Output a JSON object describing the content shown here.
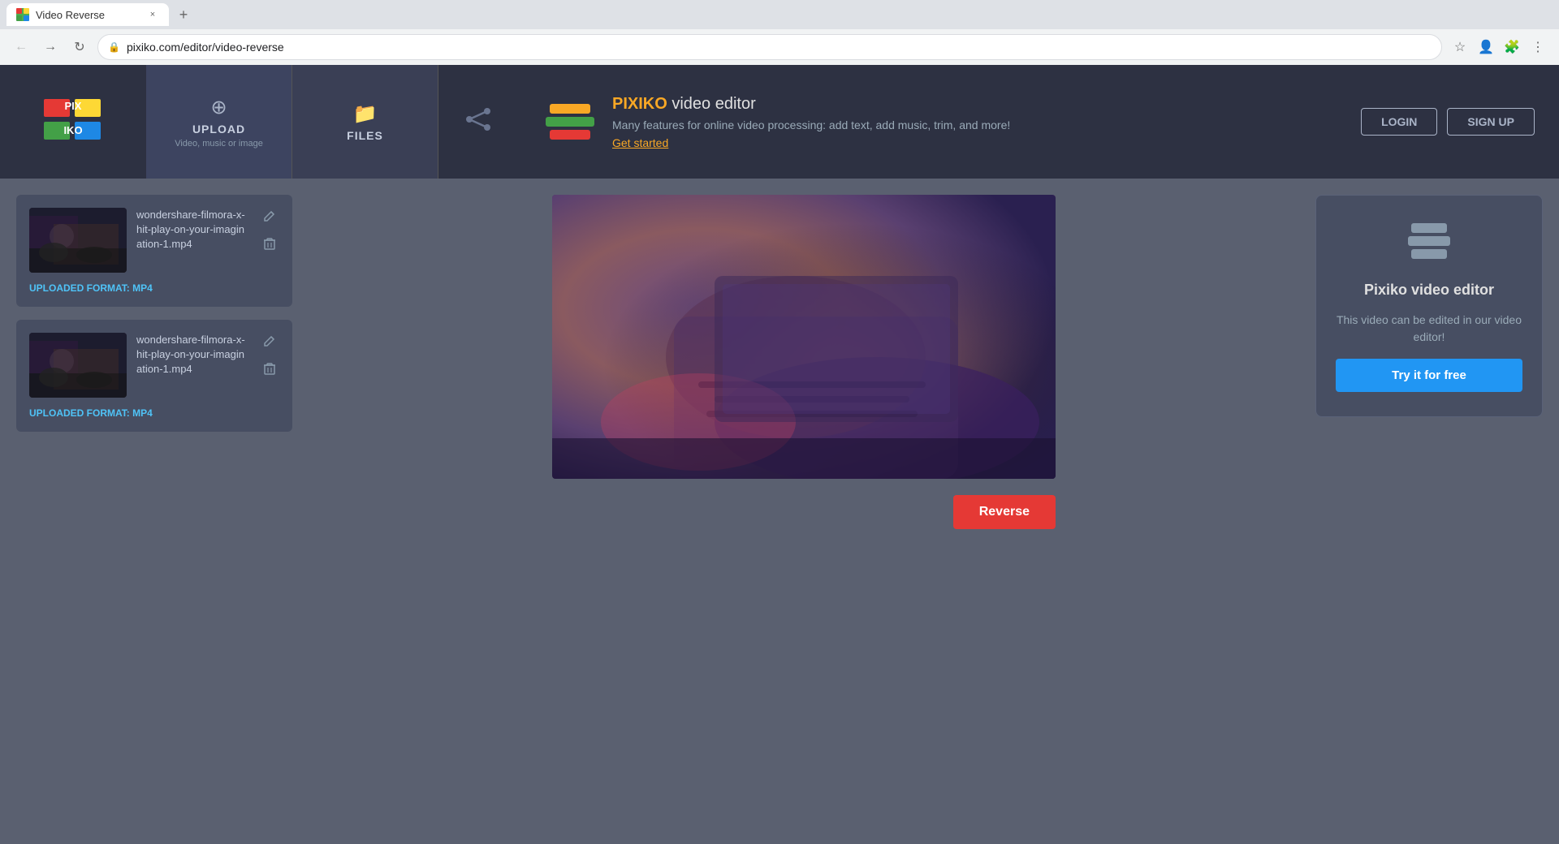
{
  "browser": {
    "tab_title": "Video Reverse",
    "url": "pixiko.com/editor/video-reverse",
    "tab_close": "×",
    "tab_new": "+"
  },
  "header": {
    "logo_text_pix": "PIX",
    "logo_text_iko": "IKO",
    "logo_subtext": "KO",
    "upload_label": "UPLOAD",
    "upload_sublabel": "Video, music or image",
    "files_label": "FILES",
    "promo_title_pixiko": "PIXIKO",
    "promo_title_rest": " video editor",
    "promo_desc": "Many features for online video processing: add text, add music, trim, and more!",
    "promo_link": "Get started",
    "login_label": "LOGIN",
    "signup_label": "SIGN UP"
  },
  "sidebar": {
    "file1": {
      "name": "wondershare-filmora-x-hit-play-on-your-imagination-1.mp4",
      "format_label": "UPLOADED FORMAT:",
      "format_value": "MP4",
      "edit_icon": "✎",
      "delete_icon": "🗑"
    },
    "file2": {
      "name": "wondershare-filmora-x-hit-play-on-your-imagination-1.mp4",
      "format_label": "UPLOADED FORMAT:",
      "format_value": "MP4",
      "edit_icon": "✎",
      "delete_icon": "🗑"
    }
  },
  "video": {
    "reverse_button": "Reverse"
  },
  "right_panel": {
    "icon_label": "layers-icon",
    "card_title": "Pixiko video editor",
    "card_desc": "This video can be edited in our video editor!",
    "try_button": "Try it for free"
  }
}
